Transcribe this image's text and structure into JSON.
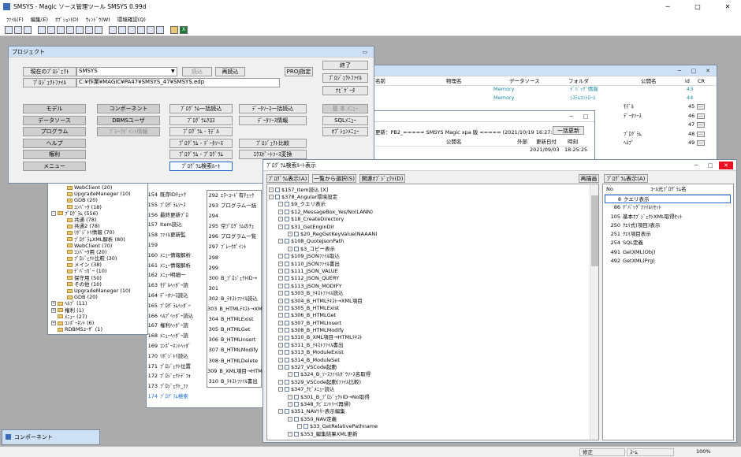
{
  "app": {
    "title": "SMSYS - Magic ソース管理ツール SMSYS 0.99d",
    "minimize": "─",
    "maximize": "□",
    "close": "✕"
  },
  "menu": [
    "ﾌｧｲﾙ(F)",
    "編集(E)",
    "ｵﾌﾟｼｮﾝ(O)",
    "ｳｨﾝﾄﾞｳ(W)",
    "環境確認(Q)"
  ],
  "toolbar_icons": [
    "new-icon",
    "open-icon",
    "save-icon",
    "cut-icon",
    "copy-icon",
    "paste-icon",
    "find-icon",
    "window-icon",
    "window-icon",
    "window-icon",
    "window-icon",
    "window-icon",
    "window-icon",
    "window-icon",
    "window-icon",
    "window-icon",
    "folder-icon",
    "excel-icon"
  ],
  "project": {
    "title": "プロジェクト",
    "current_label": "現在のﾌﾟﾛｼﾞｪｸﾄ",
    "current_value": "SMSYS",
    "read_btn": "読込",
    "reread_btn": "再読込",
    "proj_btn": "PROJ指定",
    "file_label": "ﾌﾟﾛｼﾞｪｸﾄﾌｧｲﾙ",
    "file_value": "C:¥作業¥MAGIC¥PA47¥SMSYS_47¥SMSYS.edp",
    "right_btns": [
      "終了",
      "ﾌﾟﾛｼﾞｪｸﾄﾌｧｲﾙ",
      "ﾅﾋﾞｹﾞｰﾀ"
    ],
    "col1": [
      "モデル",
      "データソース",
      "プログラム",
      "ヘルプ",
      "権利",
      "メニュー"
    ],
    "col2": [
      "コンポーネント",
      "DBMSユーザ",
      "ﾌﾞﾚｰｸﾎﾟｲﾝﾄ情報"
    ],
    "col3": [
      "ﾌﾟﾛｸﾞﾗﾑ一括読込",
      "ﾌﾟﾛｸﾞﾗﾑｸﾛｽ",
      "ﾌﾟﾛｸﾞﾗﾑ - ﾓﾃﾞﾙ",
      "ﾌﾟﾛｸﾞﾗﾑ - ﾃﾞｰﾀｿｰｽ",
      "ﾌﾟﾛｸﾞﾗﾑ - ﾌﾟﾛｸﾞﾗﾑ",
      "ﾌﾟﾛｸﾞﾗﾑ検索ﾙｰﾄ"
    ],
    "col4": [
      "ﾃﾞｰﾀｿｰｽ一括読込",
      "ﾃﾞｰﾀｿｰｽ情報",
      "",
      "ﾌﾟﾛｼﾞｪｸﾄ比較",
      "ｴｸｽﾎﾟｰﾄｿｰｽ変換"
    ],
    "col5": [
      "基 本 ﾒﾆｭｰ",
      "SQLﾒﾆｭｰ",
      "ｵﾌﾟｼｮﾝﾒﾆｭｰ"
    ]
  },
  "ds_window": {
    "headers": [
      "名前",
      "物理名",
      "データソース",
      "フォルダ",
      "公開名",
      "id",
      "CR"
    ],
    "rows": [
      {
        "ds": "Memory",
        "folder": "ﾃﾞﾊﾞｯｸﾞ情報",
        "id": "43"
      },
      {
        "ds": "Memory",
        "folder": "ｼｽﾃﾑｺﾝﾄﾛｰﾙ",
        "id": "44"
      }
    ],
    "side": [
      {
        "name": "ﾓﾃﾞﾙ",
        "id": "45"
      },
      {
        "name": "ﾃﾞｰﾀｿｰｽ",
        "id": "46"
      },
      {
        "name": "",
        "id": "47"
      },
      {
        "name": "ﾌﾟﾛｸﾞﾗﾑ",
        "id": "48"
      },
      {
        "name": "ﾍﾙﾌﾟ",
        "id": "49"
      }
    ]
  },
  "prog_window": {
    "info": "更新：PB2_===== SMSYS Magic xpa 版 ===== (2021/10/19 16:27:07)",
    "update_btn": "一括更新",
    "headers": [
      "公開名",
      "外部",
      "更新日付",
      "時刻",
      "id",
      "CR"
    ],
    "row": {
      "date": "2021/09/03",
      "time": "18:25:25",
      "id": "164"
    }
  },
  "tree_left": [
    "WebClient (20)",
    "UpgradeManeger (10)",
    "GDB (20)",
    "ｺﾝﾊﾞｰﾀ (18)",
    "ﾌﾟﾛｸﾞﾗﾑ (556)",
    "共通 (78)",
    "共通2 (78)",
    "ﾘﾎﾟｼﾞﾄﾘ情報 (70)",
    "ﾌﾟﾛｸﾞﾗﾑXML解析 (80)",
    "WebClient (70)",
    "ｺﾝﾊﾞｰﾀ用 (20)",
    "ﾌﾟﾛｼﾞｪｸﾄ比較 (30)",
    "メイン (38)",
    "ﾃﾞﾊﾞｯｶﾞｰ (10)",
    "保守用 (50)",
    "その他 (10)",
    "UpgradeManeger (10)",
    "GDB (20)",
    "ﾍﾙﾌﾟ (11)",
    "権利 (1)",
    "ﾒﾆｭｰ (27)",
    "ｺﾝﾎﾟｰﾈﾝﾄ (6)",
    "RDBMSﾕｰｻﾞ (1)"
  ],
  "prog_list": [
    [
      "154",
      "既存IDﾁｪｯｸ"
    ],
    [
      "155",
      "ﾌﾟﾛｸﾞﾗﾑｿｰｽ"
    ],
    [
      "156",
      "最終更新ﾌﾟﾛ"
    ],
    [
      "157",
      "Item読込"
    ],
    [
      "158",
      "ﾌｧｲﾙ更新監"
    ],
    [
      "159",
      ""
    ],
    [
      "160",
      "ﾒﾆｭｰ情報解析"
    ],
    [
      "161",
      "ﾒﾆｭｰ情報解析"
    ],
    [
      "162",
      "ﾒﾆｭｰ明細一"
    ],
    [
      "163",
      "ﾓﾃﾞﾙﾍｯﾀﾞｰ読"
    ],
    [
      "164",
      "ﾃﾞｰﾀｿｰｽ読込"
    ],
    [
      "165",
      "ﾌﾟﾛｸﾞﾗﾑﾍｯﾀﾞｰ"
    ],
    [
      "166",
      "ﾍﾙﾌﾟﾍｯﾀﾞｰ読込"
    ],
    [
      "167",
      "権利ﾍｯﾀﾞｰ読"
    ],
    [
      "168",
      "ﾒﾆｭｰﾍｯﾀﾞｰ読"
    ],
    [
      "169",
      "ｺﾝﾎﾟｰﾈﾝﾄﾍｯﾀﾞ"
    ],
    [
      "170",
      "ﾘﾎﾟｼﾞﾄﾘ読込"
    ],
    [
      "171",
      "ﾌﾟﾛｼﾞｪｸﾄ位置"
    ],
    [
      "172",
      "ﾌﾟﾛｼﾞｪｸﾄﾃﾞﾌｫ"
    ],
    [
      "173",
      "ﾌﾟﾛｼﾞｪｸﾄ_ﾌｧ"
    ],
    [
      "174",
      "ﾌﾟﾛｸﾞﾗﾑ検索"
    ]
  ],
  "prog_list2": [
    [
      "292",
      "ｴﾗｰｺｰﾄﾞ有ﾁｪｯｸ"
    ],
    [
      "293",
      "プログラム一括"
    ],
    [
      "294",
      ""
    ],
    [
      "295",
      "空ﾌﾟﾛｸﾞﾗﾑのﾁｪ"
    ],
    [
      "296",
      "プログラム一覧"
    ],
    [
      "297",
      "ﾌﾞﾚｰｸﾎﾟｲﾝﾄ"
    ],
    [
      "298",
      ""
    ],
    [
      "299",
      ""
    ],
    [
      "300",
      "B_ﾌﾟﾛｼﾞｪｸﾄID→"
    ],
    [
      "301",
      ""
    ],
    [
      "302",
      "B_ﾃｷｽﾄﾌｧｲﾙ読込"
    ],
    [
      "303",
      "B_HTMLﾃｷｽﾄ→XM"
    ],
    [
      "304",
      "B_HTMLExist"
    ],
    [
      "305",
      "B_HTMLGet"
    ],
    [
      "306",
      "B_HTMLInsert"
    ],
    [
      "307",
      "B_HTMLModify"
    ],
    [
      "308",
      "B_HTMLDelete"
    ],
    [
      "309",
      "B_XML項目→HTM"
    ],
    [
      "310",
      "B_ﾃｷｽﾄﾌｧｲﾙ書出"
    ]
  ],
  "search": {
    "title": "ﾌﾟﾛｸﾞﾗﾑ検索ﾙｰﾄ表示",
    "btns": [
      "ﾌﾟﾛｸﾞﾗﾑ表示(A)",
      "一覧から選択(S)",
      "関連ｵﾌﾞｼﾞｪｸﾄ(D)",
      "再描画"
    ],
    "right_btn": "ﾌﾟﾛｸﾞﾗﾑ表示(A)",
    "tree": [
      [
        0,
        "$157_Item読込 [X]"
      ],
      [
        0,
        "$378_Angular環境設定"
      ],
      [
        1,
        "$9_クエリ表示"
      ],
      [
        1,
        "$12_MessageBox_Yes/No(LANN)"
      ],
      [
        1,
        "$18_CreateDirectory"
      ],
      [
        1,
        "$31_GetEnginDir"
      ],
      [
        2,
        "$20_RegGetKeyValue(NAAAN)"
      ],
      [
        1,
        "$108_QuoteJsonPath"
      ],
      [
        2,
        "$3_コピー表示"
      ],
      [
        1,
        "$109_JSONﾌｧｲﾙ取込"
      ],
      [
        1,
        "$110_JSONﾌｧｲﾙ書出"
      ],
      [
        1,
        "$111_JSON_VALUE"
      ],
      [
        1,
        "$112_JSON_QUERY"
      ],
      [
        1,
        "$113_JSON_MODIFY"
      ],
      [
        1,
        "$303_B_ﾃｷｽﾄﾌｧｲﾙ読込"
      ],
      [
        1,
        "$304_B_HTMLﾃｷｽﾄ→XML項目"
      ],
      [
        1,
        "$305_B_HTMLExist"
      ],
      [
        1,
        "$306_B_HTMLGet"
      ],
      [
        1,
        "$307_B_HTMLInsert"
      ],
      [
        1,
        "$308_B_HTMLModify"
      ],
      [
        1,
        "$310_B_XML項目→HTMLﾃｷｽﾄ"
      ],
      [
        1,
        "$311_B_ﾃｷｽﾄﾌｧｲﾙ書出"
      ],
      [
        1,
        "$313_B_ModuleExist"
      ],
      [
        1,
        "$314_B_ModuleSet"
      ],
      [
        1,
        "$327_VSCode起動"
      ],
      [
        2,
        "$324_B_ｿｰｽﾌｧｲﾙﾀﾞｳｿｰｽ名取得"
      ],
      [
        1,
        "$329_VSCode起動(ﾌｧｲﾙ比較)"
      ],
      [
        1,
        "$347_ﾅﾋﾞﾒﾆｭｰ読込"
      ],
      [
        2,
        "$301_B_ﾌﾟﾛｼﾞｪｸﾄID→No取得"
      ],
      [
        2,
        "$348_ﾅﾋﾞｴﾝﾄﾘｰ(再帰)"
      ],
      [
        1,
        "$351_NAVﾂﾘｰ表示編集"
      ],
      [
        2,
        "$350_NAV定義"
      ],
      [
        3,
        "$33_GetRelativePathname"
      ],
      [
        2,
        "$353_編集結果XML更新"
      ]
    ],
    "list_headers": [
      "No",
      "ｺｰﾙ元ﾌﾟﾛｸﾞﾗﾑ名"
    ],
    "list": [
      [
        "8",
        "クエリ表示"
      ],
      [
        "86",
        "ﾃﾞﾊﾞｯｸﾞﾌｧｲﾙﾘｾｯﾄ"
      ],
      [
        "105",
        "基本ｵﾌﾞｼﾞｪｸﾄXML取得ｾｯﾄ"
      ],
      [
        "250",
        "ｸｴﾘ式(項目)表示"
      ],
      [
        "251",
        "ｸｴﾘ項目表示"
      ],
      [
        "254",
        "SQL定義"
      ],
      [
        "491",
        "GetXML(Obj)"
      ],
      [
        "492",
        "GetXML(Prg)"
      ]
    ]
  },
  "component": {
    "title": "コンポーネント"
  },
  "status": {
    "left": "修正",
    "mode": "ｽｰﾑ",
    "zoom": "100%"
  }
}
